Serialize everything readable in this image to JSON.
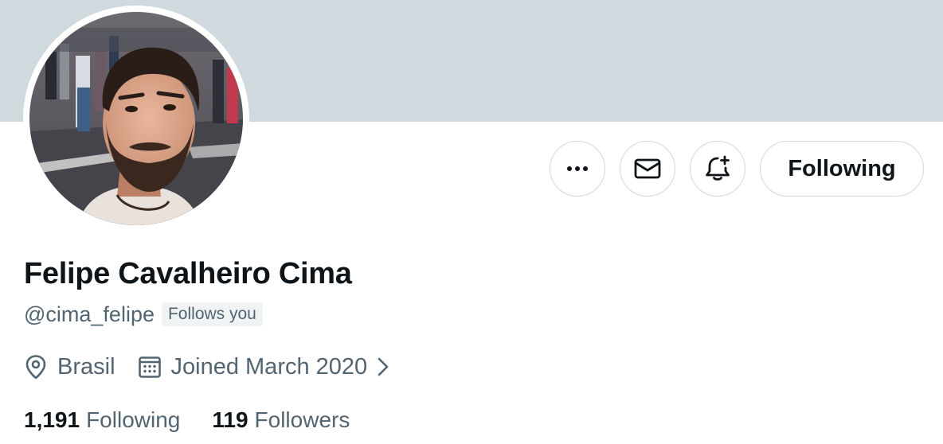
{
  "profile": {
    "display_name": "Felipe Cavalheiro Cima",
    "handle": "@cima_felipe",
    "follows_you_badge": "Follows you",
    "location": "Brasil",
    "joined": "Joined March 2020"
  },
  "actions": {
    "more_icon": "more-icon",
    "message_icon": "envelope-icon",
    "notify_icon": "bell-plus-icon",
    "following_label": "Following"
  },
  "stats": {
    "following_count": "1,191",
    "following_label": "Following",
    "followers_count": "119",
    "followers_label": "Followers"
  },
  "colors": {
    "banner": "#cfd9de",
    "text_primary": "#0f1419",
    "text_secondary": "#536471",
    "border": "#cfd9de",
    "badge_bg": "#eff3f4"
  }
}
